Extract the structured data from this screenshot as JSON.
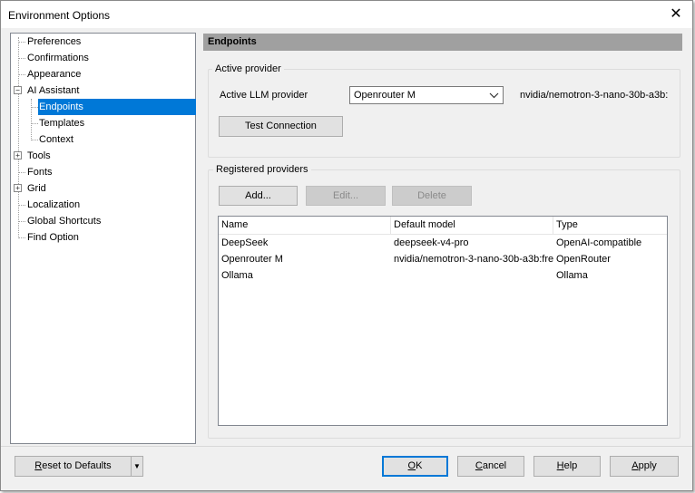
{
  "window": {
    "title": "Environment Options",
    "close_glyph": "✕"
  },
  "tree": {
    "items": [
      {
        "label": "Preferences"
      },
      {
        "label": "Confirmations"
      },
      {
        "label": "Appearance"
      },
      {
        "label": "AI Assistant",
        "expander": "−"
      },
      {
        "label": "Endpoints",
        "selected": true
      },
      {
        "label": "Templates"
      },
      {
        "label": "Context"
      },
      {
        "label": "Tools",
        "expander": "+"
      },
      {
        "label": "Fonts"
      },
      {
        "label": "Grid",
        "expander": "+"
      },
      {
        "label": "Localization"
      },
      {
        "label": "Global Shortcuts"
      },
      {
        "label": "Find Option"
      }
    ]
  },
  "panel": {
    "header": "Endpoints",
    "active_provider": {
      "group_label": "Active provider",
      "llm_label": "Active LLM provider",
      "selected_provider": "Openrouter M",
      "model_text": "nvidia/nemotron-3-nano-30b-a3b:",
      "test_button": "Test Connection"
    },
    "registered": {
      "group_label": "Registered providers",
      "add_button": "Add...",
      "edit_button": "Edit...",
      "delete_button": "Delete",
      "columns": [
        "Name",
        "Default model",
        "Type"
      ],
      "rows": [
        [
          "DeepSeek",
          "deepseek-v4-pro",
          "OpenAI-compatible"
        ],
        [
          "Openrouter M",
          "nvidia/nemotron-3-nano-30b-a3b:fre",
          "OpenRouter"
        ],
        [
          "Ollama",
          "",
          "Ollama"
        ]
      ]
    }
  },
  "footer": {
    "reset_button": "Reset to Defaults",
    "reset_dropdown_glyph": "▼",
    "ok_button": "OK",
    "cancel_button": "Cancel",
    "help_button": "Help",
    "apply_button": "Apply"
  },
  "colors": {
    "selection": "#0078d7",
    "panel_header": "#a0a0a0",
    "dialog_bg": "#f0f0f0"
  }
}
